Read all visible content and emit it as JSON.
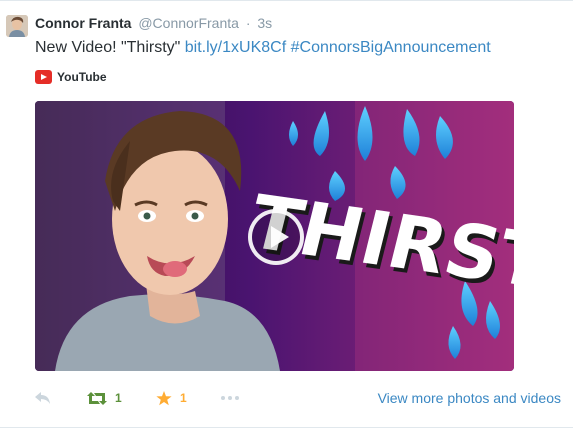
{
  "tweet": {
    "author_name": "Connor Franta",
    "handle": "@ConnorFranta",
    "separator": "·",
    "timestamp": "3s",
    "text_prefix": "New Video! \"Thirsty\" ",
    "link": "bit.ly/1xUK8Cf",
    "hashtag": "#ConnorsBigAnnouncement"
  },
  "card": {
    "source": "YouTube",
    "thumbnail_title": "THIRSTY"
  },
  "actions": {
    "retweet_count": "1",
    "favorite_count": "1",
    "view_more_label": "View more photos and videos"
  },
  "colors": {
    "link": "#3b88c3",
    "retweet": "#5c913b",
    "favorite": "#ffac33",
    "youtube": "#e52d27"
  }
}
